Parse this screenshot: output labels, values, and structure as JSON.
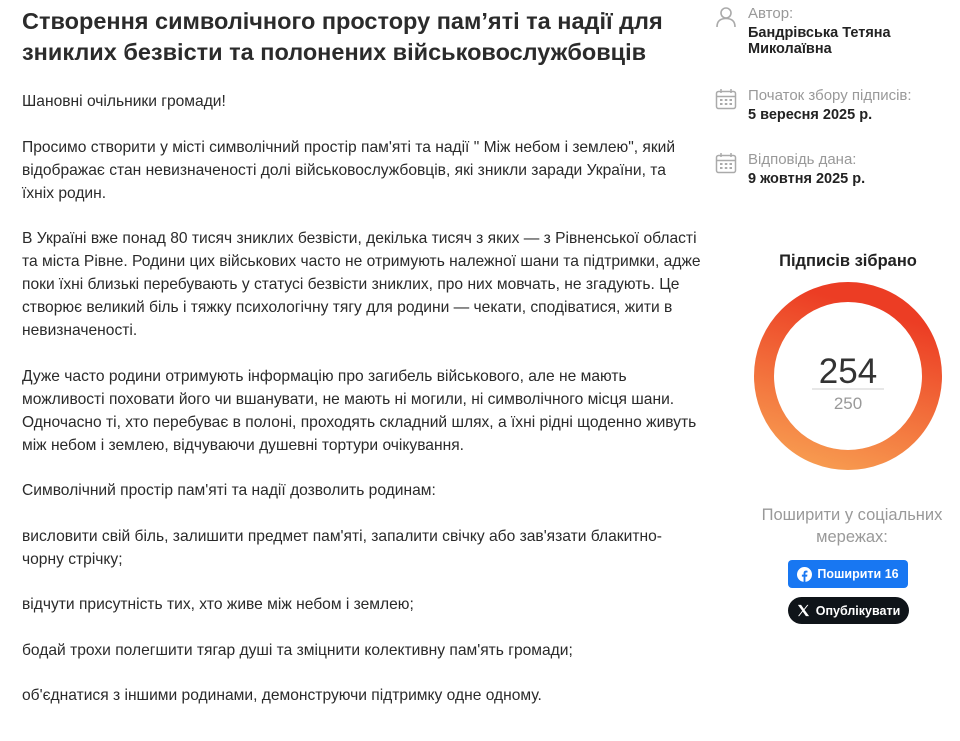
{
  "petition": {
    "title": "Створення символічного простору пам’яті та надії для зниклих безвісти та полонених військовослужбовців",
    "paragraphs": [
      "Шановні очільники громади!",
      "Просимо створити у місті символічний простір пам'яті та надії \" Між небом і землею\", який відображає стан невизначеності долі військовослужбовців, які зникли заради України, та їхніх родин.",
      "В Україні вже понад 80 тисяч зниклих безвісти, декілька тисяч з яких — з Рівненської області та міста Рівне. Родини цих військових часто не отримують належної шани та підтримки, адже поки їхні близькі перебувають у статусі безвісти зниклих, про них мовчать, не згадують. Це створює великий біль і тяжку психологічну тягу для родини — чекати, сподіватися, жити в невизначеності.",
      "Дуже часто родини отримують інформацію про загибель військового, але не мають можливості поховати його чи вшанувати, не мають ні могили, ні символічного місця шани. Одночасно ті, хто перебуває в полоні, проходять складний шлях, а їхні рідні щоденно живуть між небом і землею, відчуваючи душевні тортури очікування.",
      "Символічний простір пам'яті та надії дозволить родинам:",
      "висловити свій біль, залишити предмет пам'яті, запалити свічку або зав'язати блакитно-чорну стрічку;",
      "відчути присутність тих, хто живе між небом і землею;",
      "бодай трохи полегшити тягар душі та зміцнити колективну пам'ять громади;",
      "об'єднатися з іншими родинами, демонструючи підтримку одне одному."
    ]
  },
  "sidebar": {
    "author_label": "Автор:",
    "author_value": "Бандрівська Тетяна Миколаївна",
    "start_label": "Початок збору підписів:",
    "start_value": "5 вересня 2025 р.",
    "answer_label": "Відповідь дана:",
    "answer_value": "9 жовтня 2025 р.",
    "signatures_title": "Підписів зібрано",
    "signatures_count": "254",
    "signatures_goal": "250",
    "progress_fraction": 1.0,
    "share_title": "Поширити у соціальних мережах:",
    "fb_label": "Поширити 16",
    "x_label": "Опублікувати"
  },
  "icons": {
    "author": "user-icon",
    "start": "calendar-icon",
    "answer": "calendar-icon",
    "facebook": "facebook-icon",
    "x": "x-logo-icon"
  },
  "colors": {
    "ring_start": "#f8a052",
    "ring_end": "#ec3d24",
    "facebook": "#1877f2",
    "x_button": "#0f1419",
    "muted": "#999999"
  }
}
